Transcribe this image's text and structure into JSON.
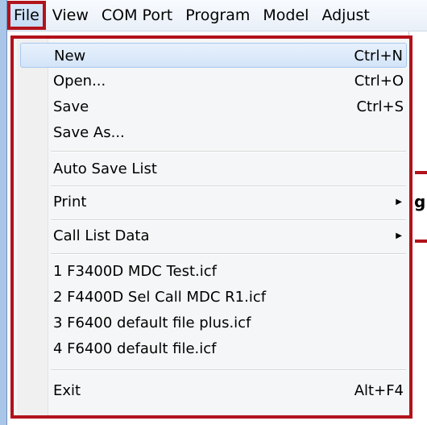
{
  "menubar": {
    "items": [
      "File",
      "View",
      "COM Port",
      "Program",
      "Model",
      "Adjust"
    ]
  },
  "background": {
    "partial_text": "g"
  },
  "file_menu": {
    "new": {
      "label": "New",
      "shortcut": "Ctrl+N"
    },
    "open": {
      "label": "Open...",
      "shortcut": "Ctrl+O"
    },
    "save": {
      "label": "Save",
      "shortcut": "Ctrl+S"
    },
    "save_as": {
      "label": "Save As..."
    },
    "auto_save_list": {
      "label": "Auto Save List"
    },
    "print": {
      "label": "Print"
    },
    "call_list_data": {
      "label": "Call List Data"
    },
    "recent": [
      "1 F3400D MDC Test.icf",
      "2 F4400D Sel Call MDC R1.icf",
      "3 F6400 default file plus.icf",
      "4 F6400 default file.icf"
    ],
    "exit": {
      "label": "Exit",
      "shortcut": "Alt+F4"
    }
  },
  "colors": {
    "highlight_border": "#b2121b",
    "menu_background": "#f5f6f7"
  }
}
